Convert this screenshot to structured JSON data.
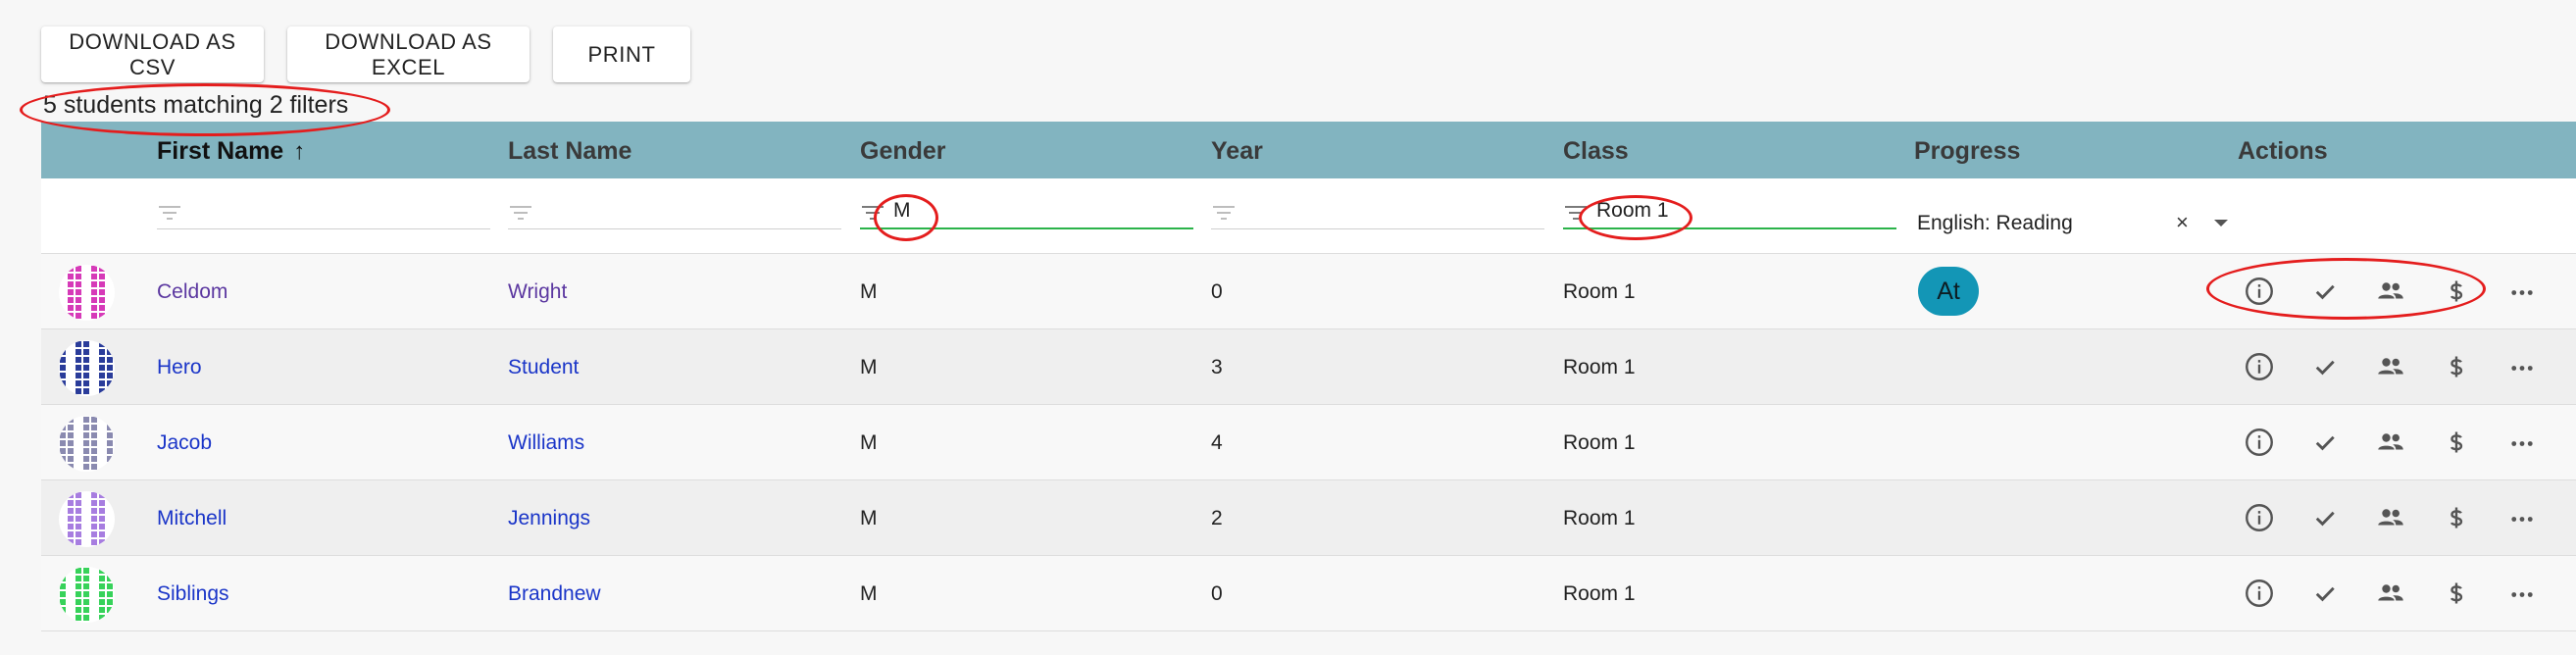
{
  "toolbar": {
    "csv_label": "DOWNLOAD AS CSV",
    "excel_label": "DOWNLOAD AS EXCEL",
    "print_label": "PRINT"
  },
  "status": {
    "match_count": "5 students matching 2 filters"
  },
  "columns": {
    "first_name": "First Name",
    "last_name": "Last Name",
    "gender": "Gender",
    "year": "Year",
    "class": "Class",
    "progress": "Progress",
    "actions": "Actions"
  },
  "sort": {
    "column": "First Name",
    "direction": "ascending",
    "icon": "arrow-up-icon"
  },
  "filters": {
    "gender": "M",
    "class": "Room 1",
    "progress": "English: Reading",
    "progress_clear": "×"
  },
  "rows": [
    {
      "first": "Celdom",
      "last": "Wright",
      "gender": "M",
      "year": "0",
      "class": "Room 1",
      "progress": "At",
      "avatar_color": "#d63ab8"
    },
    {
      "first": "Hero",
      "last": "Student",
      "gender": "M",
      "year": "3",
      "class": "Room 1",
      "progress": "",
      "avatar_color": "#2a3c9a"
    },
    {
      "first": "Jacob",
      "last": "Williams",
      "gender": "M",
      "year": "4",
      "class": "Room 1",
      "progress": "",
      "avatar_color": "#8a8ab0"
    },
    {
      "first": "Mitchell",
      "last": "Jennings",
      "gender": "M",
      "year": "2",
      "class": "Room 1",
      "progress": "",
      "avatar_color": "#a77de0"
    },
    {
      "first": "Siblings",
      "last": "Brandnew",
      "gender": "M",
      "year": "0",
      "class": "Room 1",
      "progress": "",
      "avatar_color": "#37d25a"
    }
  ],
  "action_icons": [
    "info-icon",
    "check-icon",
    "people-icon",
    "dollar-icon",
    "more-icon"
  ],
  "colors": {
    "header_bg": "#82b4c0",
    "link": "#1a35c8",
    "visited_link": "#5b37a0",
    "active_filter_underline": "#2bb34a",
    "progress_badge": "#1396b6",
    "annotation": "#e41d1d"
  }
}
